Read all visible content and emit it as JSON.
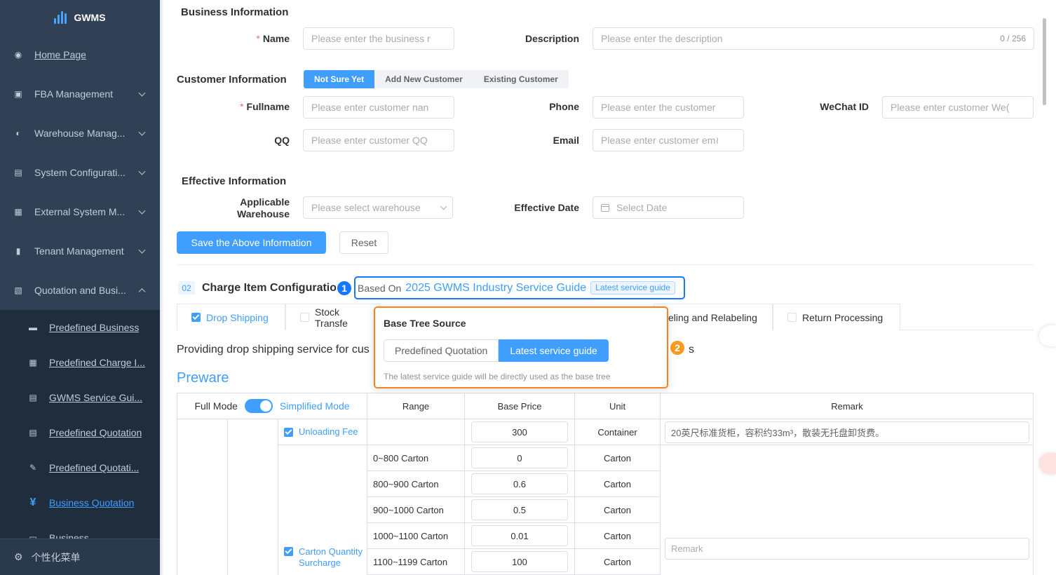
{
  "sidebar": {
    "logo_text": "GWMS",
    "items": [
      {
        "label": "Home Page",
        "icon": "dashboard-icon"
      },
      {
        "label": "FBA Management",
        "icon": "box-icon"
      },
      {
        "label": "Warehouse Manag...",
        "icon": "globe-icon"
      },
      {
        "label": "System Configurati...",
        "icon": "document-icon"
      },
      {
        "label": "External System M...",
        "icon": "grid-icon"
      },
      {
        "label": "Tenant Management",
        "icon": "chart-icon"
      },
      {
        "label": "Quotation and Busi...",
        "icon": "file-icon"
      }
    ],
    "subitems": [
      {
        "label": "Predefined Business",
        "icon": "folder-icon"
      },
      {
        "label": "Predefined Charge I...",
        "icon": "table-icon"
      },
      {
        "label": "GWMS Service Gui...",
        "icon": "list-doc-icon"
      },
      {
        "label": "Predefined Quotation",
        "icon": "list-doc-icon"
      },
      {
        "label": "Predefined Quotati...",
        "icon": "edit-doc-icon"
      },
      {
        "label": "Business Quotation",
        "icon": "yen-icon"
      },
      {
        "label": "Business",
        "icon": "calendar-icon"
      }
    ],
    "personalize": "个性化菜单"
  },
  "business": {
    "title": "Business Information",
    "name_label": "Name",
    "name_placeholder": "Please enter the business r",
    "desc_label": "Description",
    "desc_placeholder": "Please enter the description",
    "desc_counter": "0 / 256"
  },
  "customer": {
    "title": "Customer Information",
    "modes": [
      "Not Sure Yet",
      "Add New Customer",
      "Existing Customer"
    ],
    "fullname_label": "Fullname",
    "fullname_placeholder": "Please enter customer nan",
    "phone_label": "Phone",
    "phone_placeholder": "Please enter the customer",
    "wechat_label": "WeChat ID",
    "wechat_placeholder": "Please enter customer We(",
    "qq_label": "QQ",
    "qq_placeholder": "Please enter customer QQ",
    "email_label": "Email",
    "email_placeholder": "Please enter customer em≀"
  },
  "effective": {
    "title": "Effective Information",
    "warehouse_label_1": "Applicable",
    "warehouse_label_2": "Warehouse",
    "warehouse_placeholder": "Please select warehouse",
    "date_label": "Effective Date",
    "date_placeholder": "Select Date"
  },
  "actions": {
    "save": "Save the Above Information",
    "reset": "Reset"
  },
  "charge": {
    "number": "02",
    "title": "Charge Item Configuratio",
    "based_on": "Based On",
    "guide_name": "2025 GWMS Industry Service Guide",
    "guide_tag": "Latest service guide",
    "marker1": "1",
    "marker2": "2"
  },
  "tabs": [
    {
      "label": "Drop Shipping",
      "checked": true
    },
    {
      "label": "Stock Transfe",
      "checked": false
    },
    {
      "label": "eling and Relabeling",
      "checked": false
    },
    {
      "label": "Return Processing",
      "checked": false
    }
  ],
  "service_desc": "Providing drop shipping service for cus",
  "service_desc_tail": "s",
  "popover": {
    "title": "Base Tree Source",
    "options": [
      "Predefined Quotation",
      "Latest service guide"
    ],
    "selected": "Latest service guide",
    "desc": "The latest service guide will be directly used as the base tree"
  },
  "preware": "Preware",
  "table": {
    "mode_full": "Full Mode",
    "mode_simplified": "Simplified Mode",
    "headers": [
      "Range",
      "Base Price",
      "Unit",
      "Remark"
    ],
    "unloading": {
      "label": "Unloading Fee",
      "price": "300",
      "unit": "Container",
      "remark": "20英尺标准货柜，容积约33m³，散装无托盘卸货费。"
    },
    "carton": {
      "label": "Carton Quantity Surcharge",
      "remark_placeholder": "Remark",
      "rows": [
        {
          "range": "0~800 Carton",
          "price": "0",
          "unit": "Carton"
        },
        {
          "range": "800~900 Carton",
          "price": "0.6",
          "unit": "Carton"
        },
        {
          "range": "900~1000 Carton",
          "price": "0.5",
          "unit": "Carton"
        },
        {
          "range": "1000~1100 Carton",
          "price": "0.01",
          "unit": "Carton"
        },
        {
          "range": "1100~1199 Carton",
          "price": "100",
          "unit": "Carton"
        }
      ]
    }
  },
  "colors": {
    "primary": "#409eff",
    "sidebar": "#304156",
    "callout_blue": "#1677ff",
    "callout_orange": "#f5841f"
  }
}
